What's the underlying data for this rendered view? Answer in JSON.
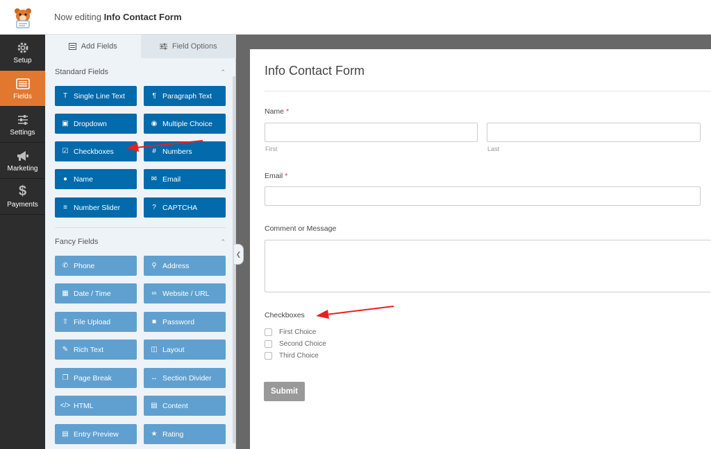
{
  "header": {
    "editing_prefix": "Now editing",
    "form_name": "Info Contact Form"
  },
  "nav": [
    {
      "label": "Setup",
      "icon": "gear-icon"
    },
    {
      "label": "Fields",
      "icon": "fields-icon",
      "active": true
    },
    {
      "label": "Settings",
      "icon": "sliders-icon"
    },
    {
      "label": "Marketing",
      "icon": "megaphone-icon"
    },
    {
      "label": "Payments",
      "icon": "dollar-icon"
    }
  ],
  "panel": {
    "tabs": [
      "Add Fields",
      "Field Options"
    ],
    "standard_title": "Standard Fields",
    "fancy_title": "Fancy Fields",
    "standard_fields": [
      "Single Line Text",
      "Paragraph Text",
      "Dropdown",
      "Multiple Choice",
      "Checkboxes",
      "Numbers",
      "Name",
      "Email",
      "Number Slider",
      "CAPTCHA"
    ],
    "fancy_fields": [
      "Phone",
      "Address",
      "Date / Time",
      "Website / URL",
      "File Upload",
      "Password",
      "Rich Text",
      "Layout",
      "Page Break",
      "Section Divider",
      "HTML",
      "Content",
      "Entry Preview",
      "Rating"
    ]
  },
  "form": {
    "title": "Info Contact Form",
    "name_label": "Name",
    "name_required": "*",
    "first_sublabel": "First",
    "last_sublabel": "Last",
    "email_label": "Email",
    "email_required": "*",
    "comment_label": "Comment or Message",
    "checkboxes_label": "Checkboxes",
    "choices": [
      "First Choice",
      "Second Choice",
      "Third Choice"
    ],
    "submit_label": "Submit"
  },
  "colors": {
    "accent": "#e27730",
    "standard_button": "#036aab",
    "fancy_button": "#5fa0d0",
    "annotation_arrow": "#e8201c"
  }
}
